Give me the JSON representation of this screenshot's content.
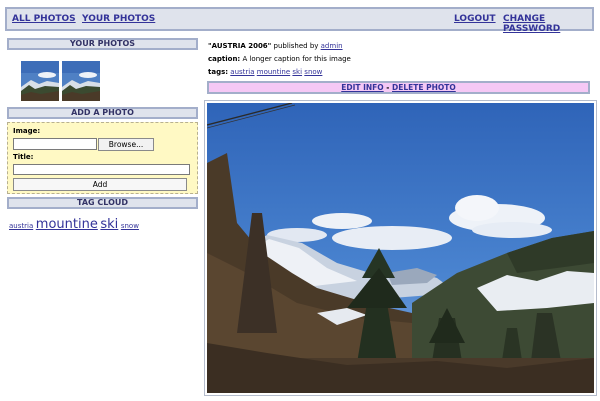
{
  "nav": {
    "all_photos": "ALL PHOTOS",
    "your_photos": "YOUR PHOTOS",
    "logout": "LOGOUT",
    "change_password": "CHANGE PASSWORD"
  },
  "sidebar": {
    "your_photos_heading": "YOUR PHOTOS",
    "add_photo_heading": "ADD A PHOTO",
    "image_label": "Image:",
    "browse_label": "Browse...",
    "title_label": "Title:",
    "title_value": "",
    "add_label": "Add",
    "tag_cloud_heading": "TAG CLOUD",
    "tags": [
      "austria",
      "mountine",
      "ski",
      "snow"
    ]
  },
  "photo": {
    "title": "\"AUSTRIA 2006\"",
    "published_by_text": " published by ",
    "author": "admin",
    "caption_label": "caption:",
    "caption": "A longer caption for this image",
    "tags_label": "tags:",
    "tags": [
      "austria",
      "mountine",
      "ski",
      "snow"
    ],
    "edit_label": "EDIT INFO",
    "separator": " - ",
    "delete_label": "DELETE PHOTO"
  },
  "colors": {
    "header_bg": "#dfe3ec",
    "header_border": "#a3aeca",
    "link": "#333399",
    "add_box_bg": "#fff9c4",
    "edit_bar_bg": "#f5c8f5"
  }
}
